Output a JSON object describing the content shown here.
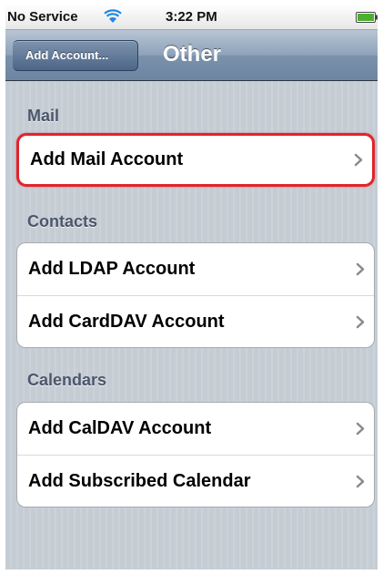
{
  "status_bar": {
    "carrier": "No Service",
    "time": "3:22 PM",
    "icons": [
      "wifi-icon",
      "battery-icon"
    ]
  },
  "nav_bar": {
    "back_label": "Add Account...",
    "title": "Other",
    "colors": {
      "bar": "#7b92ac",
      "title_text": "#ffffff"
    }
  },
  "sections": [
    {
      "header": "Mail",
      "rows": [
        {
          "label": "Add Mail Account",
          "icon": "chevron-right-icon"
        }
      ]
    },
    {
      "header": "Contacts",
      "rows": [
        {
          "label": "Add LDAP Account",
          "icon": "chevron-right-icon"
        },
        {
          "label": "Add CardDAV Account",
          "icon": "chevron-right-icon"
        }
      ]
    },
    {
      "header": "Calendars",
      "rows": [
        {
          "label": "Add CalDAV Account",
          "icon": "chevron-right-icon"
        },
        {
          "label": "Add Subscribed Calendar",
          "icon": "chevron-right-icon"
        }
      ]
    }
  ],
  "colors": {
    "background": "#c5ccd4",
    "section_header": "#4c566c",
    "highlight_border": "#e0252b",
    "chevron": "#8a8a8a"
  }
}
